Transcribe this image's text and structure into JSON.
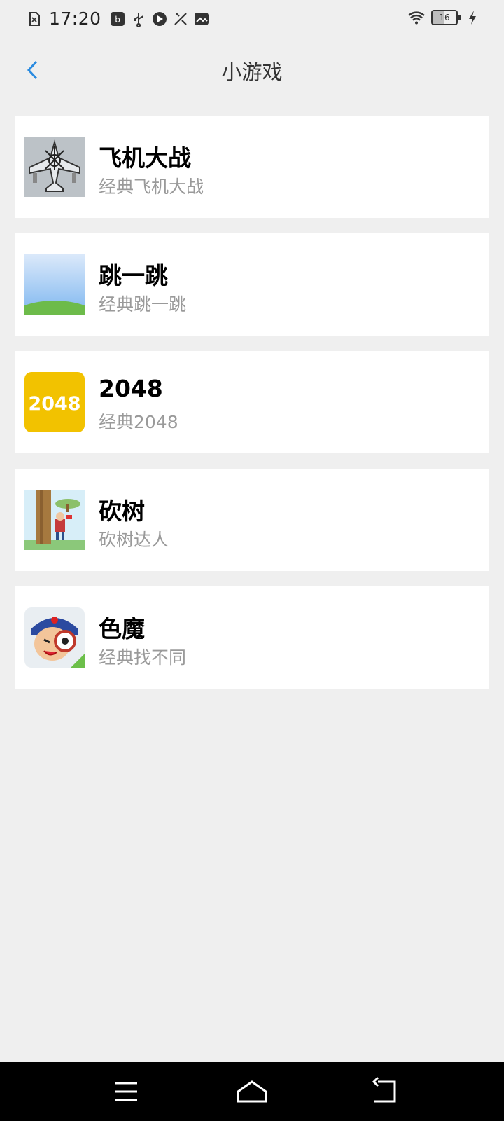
{
  "status_bar": {
    "time": "17:20",
    "battery": "16",
    "icons": [
      "sim-icon",
      "data-icon",
      "usb-icon",
      "media-icon",
      "tools-icon",
      "gallery-icon",
      "wifi-icon",
      "battery-icon",
      "charging-icon"
    ]
  },
  "header": {
    "title": "小游戏",
    "back_icon": "chevron-left-icon",
    "accent_color": "#2a8be0"
  },
  "games": [
    {
      "name": "飞机大战",
      "desc": "经典飞机大战",
      "icon": "airplane-game-icon"
    },
    {
      "name": "跳一跳",
      "desc": "经典跳一跳",
      "icon": "jump-game-icon"
    },
    {
      "name": "2048",
      "desc": "经典2048",
      "icon": "2048-game-icon",
      "icon_text": "2048",
      "icon_color": "#f2c200"
    },
    {
      "name": "砍树",
      "desc": "砍树达人",
      "icon": "chop-tree-game-icon"
    },
    {
      "name": "色魔",
      "desc": "经典找不同",
      "icon": "spot-difference-game-icon"
    }
  ],
  "nav_bar": {
    "icons": [
      "menu-icon",
      "home-icon",
      "back-icon"
    ]
  }
}
